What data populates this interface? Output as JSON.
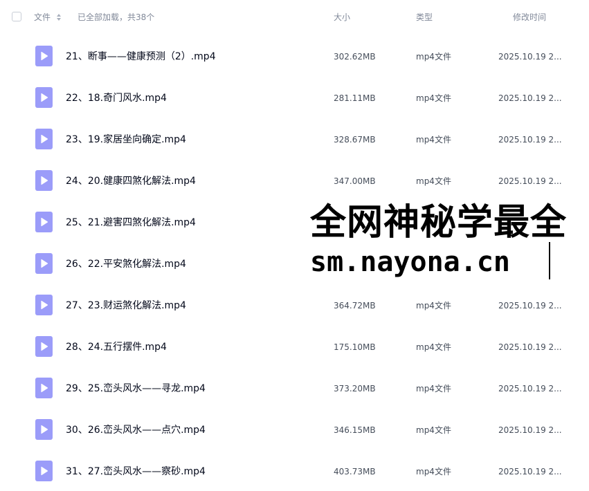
{
  "header": {
    "name_label": "文件",
    "loaded_text": "已全部加载，共38个",
    "size_label": "大小",
    "type_label": "类型",
    "modified_label": "修改时间"
  },
  "files": [
    {
      "name": "21、断事——健康预测（2）.mp4",
      "size": "302.62MB",
      "type": "mp4文件",
      "date": "2025.10.19 2..."
    },
    {
      "name": "22、18.奇门风水.mp4",
      "size": "281.11MB",
      "type": "mp4文件",
      "date": "2025.10.19 2..."
    },
    {
      "name": "23、19.家居坐向确定.mp4",
      "size": "328.67MB",
      "type": "mp4文件",
      "date": "2025.10.19 2..."
    },
    {
      "name": "24、20.健康四煞化解法.mp4",
      "size": "347.00MB",
      "type": "mp4文件",
      "date": "2025.10.19 2..."
    },
    {
      "name": "25、21.避害四煞化解法.mp4",
      "size": "",
      "type": "",
      "date": ""
    },
    {
      "name": "26、22.平安煞化解法.mp4",
      "size": "",
      "type": "",
      "date": ""
    },
    {
      "name": "27、23.财运煞化解法.mp4",
      "size": "364.72MB",
      "type": "mp4文件",
      "date": "2025.10.19 2..."
    },
    {
      "name": "28、24.五行摆件.mp4",
      "size": "175.10MB",
      "type": "mp4文件",
      "date": "2025.10.19 2..."
    },
    {
      "name": "29、25.峦头风水——寻龙.mp4",
      "size": "373.20MB",
      "type": "mp4文件",
      "date": "2025.10.19 2..."
    },
    {
      "name": "30、26.峦头风水——点穴.mp4",
      "size": "346.15MB",
      "type": "mp4文件",
      "date": "2025.10.19 2..."
    },
    {
      "name": "31、27.峦头风水——察砂.mp4",
      "size": "403.73MB",
      "type": "mp4文件",
      "date": "2025.10.19 2..."
    }
  ],
  "watermark": {
    "line1": "全网神秘学最全",
    "line2": "sm.nayona.cn"
  },
  "colors": {
    "icon": "#9b9cf9",
    "header_text": "#818999",
    "filename_text": "#03081a",
    "meta_text": "#454d5a"
  }
}
